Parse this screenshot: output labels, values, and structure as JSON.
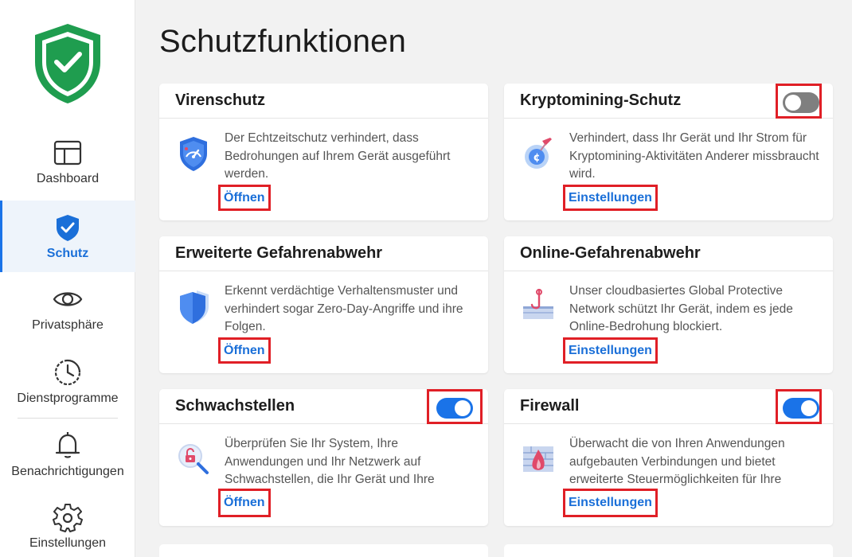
{
  "sidebar": {
    "items": [
      {
        "label": "Dashboard",
        "icon": "dashboard-icon"
      },
      {
        "label": "Schutz",
        "icon": "shield-check-icon",
        "active": true
      },
      {
        "label": "Privatsphäre",
        "icon": "eye-icon"
      },
      {
        "label": "Dienstprogramme",
        "icon": "speed-gauge-icon"
      },
      {
        "label": "Benachrichtigungen",
        "icon": "bell-icon"
      },
      {
        "label": "Einstellungen",
        "icon": "gear-icon"
      }
    ]
  },
  "main": {
    "title": "Schutzfunktionen",
    "cards": [
      {
        "title": "Virenschutz",
        "desc": "Der Echtzeitschutz verhindert, dass Bedrohungen auf Ihrem Gerät ausgeführt werden.",
        "link": "Öffnen",
        "icon": "shield-gauge-icon"
      },
      {
        "title": "Kryptomining-Schutz",
        "desc": "Verhindert, dass Ihr Gerät und Ihr Strom für Kryptomining-Aktivitäten Anderer missbraucht wird.",
        "link": "Einstellungen",
        "icon": "crypto-coin-icon",
        "toggle": "off"
      },
      {
        "title": "Erweiterte Gefahrenabwehr",
        "desc": "Erkennt verdächtige Verhaltensmuster und verhindert sogar Zero-Day-Angriffe und ihre Folgen.",
        "link": "Öffnen",
        "icon": "layered-shield-icon"
      },
      {
        "title": "Online-Gefahrenabwehr",
        "desc": "Unser cloudbasiertes Global Protective Network schützt Ihr Gerät, indem es jede Online-Bedrohung blockiert.",
        "link": "Einstellungen",
        "icon": "phishing-hook-icon"
      },
      {
        "title": "Schwachstellen",
        "desc": "Überprüfen Sie Ihr System, Ihre Anwendungen und Ihr Netzwerk auf Schwachstellen, die Ihr Gerät und Ihre",
        "link": "Öffnen",
        "icon": "magnifier-lock-icon",
        "toggle": "on"
      },
      {
        "title": "Firewall",
        "desc": "Überwacht die von Ihren Anwendungen aufgebauten Verbindungen und bietet erweiterte Steuermöglichkeiten für Ihre",
        "link": "Einstellungen",
        "icon": "firewall-icon",
        "toggle": "on"
      }
    ]
  },
  "colors": {
    "accent": "#1a73e8",
    "highlight": "#e01f26",
    "brand_green": "#1f9d4f"
  }
}
